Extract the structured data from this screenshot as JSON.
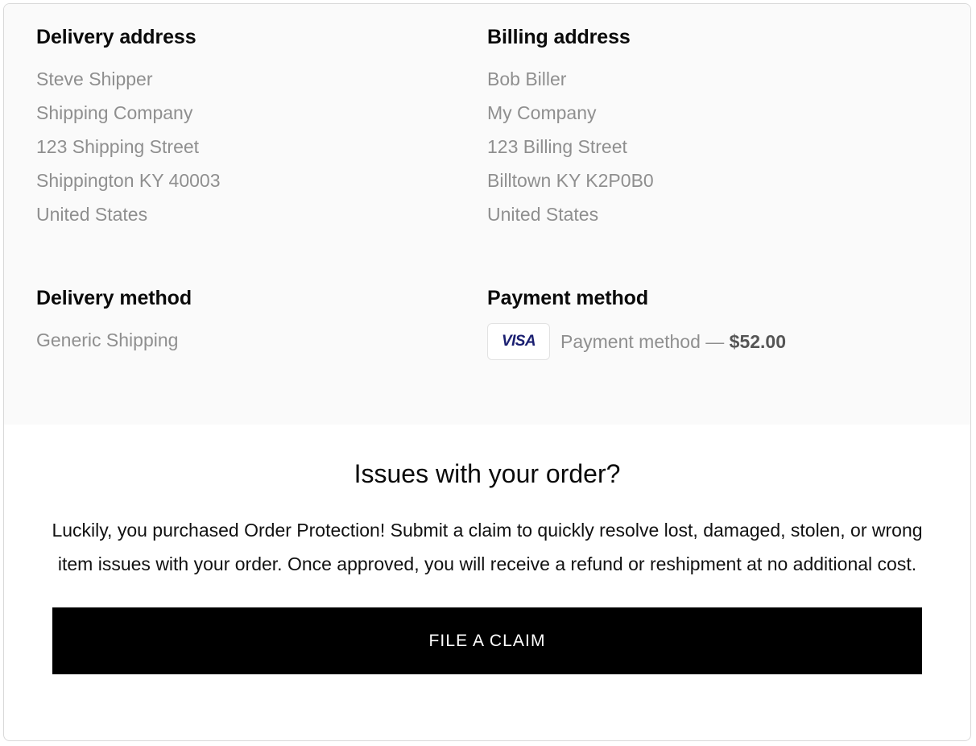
{
  "delivery_address": {
    "title": "Delivery address",
    "lines": [
      "Steve Shipper",
      "Shipping Company",
      "123 Shipping Street",
      "Shippington KY 40003",
      "United States"
    ]
  },
  "billing_address": {
    "title": "Billing address",
    "lines": [
      "Bob Biller",
      "My Company",
      "123 Billing Street",
      "Billtown KY K2P0B0",
      "United States"
    ]
  },
  "delivery_method": {
    "title": "Delivery method",
    "value": "Generic Shipping"
  },
  "payment_method": {
    "title": "Payment method",
    "card_brand": "VISA",
    "label": "Payment method",
    "separator": "—",
    "amount": "$52.00"
  },
  "issues": {
    "title": "Issues with your order?",
    "body": "Luckily, you purchased Order Protection! Submit a claim to quickly resolve lost, damaged, stolen, or wrong item issues with your order. Once approved, you will receive a refund or reshipment at no additional cost.",
    "cta_label": "FILE A CLAIM"
  },
  "colors": {
    "panel_background": "#fafafa",
    "muted_text": "#8f8f8f",
    "heading_text": "#0a0a0a",
    "amount_text": "#555555",
    "visa_navy": "#1a1f71",
    "cta_background": "#000000",
    "card_border": "#d9d9d9"
  }
}
